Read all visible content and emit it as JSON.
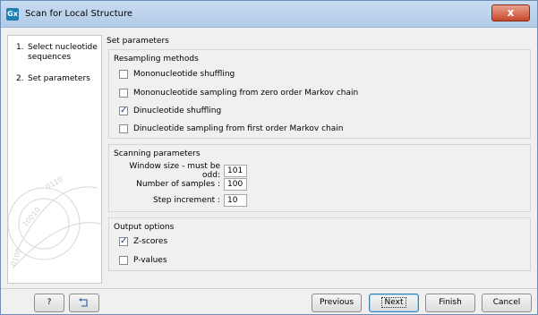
{
  "window": {
    "title": "Scan for Local Structure",
    "app_icon_text": "Gx",
    "close_label": "x"
  },
  "steps": [
    {
      "number": "1.",
      "label": "Select nucleotide sequences"
    },
    {
      "number": "2.",
      "label": "Set parameters"
    }
  ],
  "main": {
    "section_title": "Set parameters",
    "resampling": {
      "title": "Resampling methods",
      "options": [
        {
          "label": "Mononucleotide shuffling",
          "checked": false
        },
        {
          "label": "Mononucleotide sampling from zero order Markov chain",
          "checked": false
        },
        {
          "label": "Dinucleotide shuffling",
          "checked": true
        },
        {
          "label": "Dinucleotide sampling from first order Markov chain",
          "checked": false
        }
      ]
    },
    "scanning": {
      "title": "Scanning parameters",
      "window_size_label": "Window size - must be odd:",
      "window_size_value": "101",
      "samples_label": "Number of samples :",
      "samples_value": "100",
      "step_label": "Step increment :",
      "step_value": "10"
    },
    "output": {
      "title": "Output options",
      "options": [
        {
          "label": "Z-scores",
          "checked": true
        },
        {
          "label": "P-values",
          "checked": false
        }
      ]
    }
  },
  "footer": {
    "help_label": "?",
    "reset_icon": "reset-arrow-icon",
    "previous_label": "Previous",
    "next_label": "Next",
    "finish_label": "Finish",
    "cancel_label": "Cancel"
  }
}
